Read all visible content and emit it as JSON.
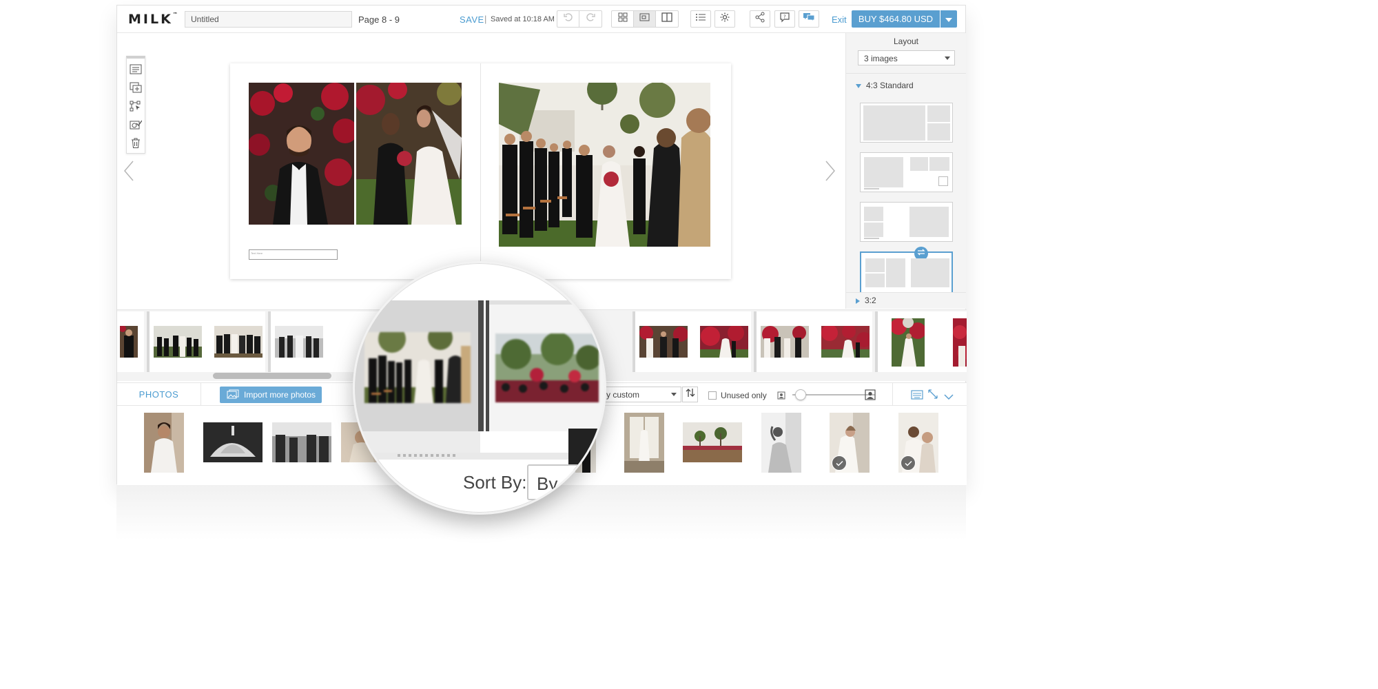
{
  "app": {
    "logo": "MILK",
    "logo_tm": "™",
    "document_title": "Untitled",
    "page_info": "Page 8 - 9",
    "save_label": "SAVE",
    "save_divider": "|",
    "saved_status": "Saved at 10:18 AM",
    "exit_label": "Exit",
    "buy_label": "BUY $464.80 USD",
    "accent_color": "#5a9fd0"
  },
  "toolbar": {
    "icons": [
      "undo-icon",
      "redo-icon",
      "grid-view-icon",
      "spread-view-icon",
      "single-page-icon",
      "list-icon",
      "settings-icon",
      "share-icon",
      "comment-icon",
      "chat-icon"
    ]
  },
  "side_tools": [
    "text-icon",
    "add-page-icon",
    "auto-fill-icon",
    "proof-icon",
    "trash-icon"
  ],
  "spread": {
    "textbox_placeholder": "Text Here"
  },
  "layout_panel": {
    "title": "Layout",
    "selected_option": "3 images",
    "section_open": "4:3 Standard",
    "section_collapsed": "3:2"
  },
  "photos_bar": {
    "tab_label": "PHOTOS",
    "import_label": "Import more photos",
    "sort_value": "By custom",
    "unused_label": "Unused only"
  },
  "magnifier": {
    "sort_label": "Sort By:",
    "sort_value_fragment": "By"
  }
}
